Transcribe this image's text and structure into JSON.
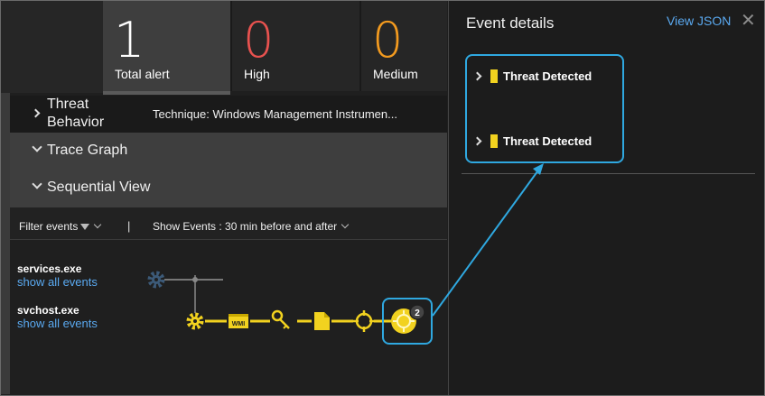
{
  "stats": [
    {
      "value": "1",
      "label": "Total alert"
    },
    {
      "value": "0",
      "label": "High"
    },
    {
      "value": "0",
      "label": "Medium"
    }
  ],
  "colors": {
    "high": "#e8524f",
    "medium": "#f29a1f",
    "accent": "#f2d21f",
    "link": "#5aa9f0",
    "highlight": "#2fa8e0"
  },
  "sections": {
    "threat_behavior": {
      "title": "Threat Behavior",
      "technique": "Technique: Windows Management Instrumen..."
    },
    "trace_graph": {
      "title": "Trace Graph"
    },
    "sequential_view": {
      "title": "Sequential View"
    }
  },
  "toolbar": {
    "filter_label": "Filter events",
    "separator": "|",
    "show_events_label": "Show Events : 30 min before and after"
  },
  "processes": [
    {
      "name": "services.exe",
      "link": "show all events"
    },
    {
      "name": "svchost.exe",
      "link": "show all events"
    }
  ],
  "chain": {
    "icons": [
      "gear-icon",
      "wmi-icon",
      "key-icon",
      "document-icon",
      "crosshair-icon",
      "threat-target-icon"
    ],
    "wmi_text": "WMI",
    "badge_count": "2"
  },
  "event_details": {
    "title": "Event details",
    "view_json": "View JSON",
    "close": "✕",
    "events": [
      {
        "label": "Threat Detected"
      },
      {
        "label": "Threat Detected"
      }
    ]
  }
}
